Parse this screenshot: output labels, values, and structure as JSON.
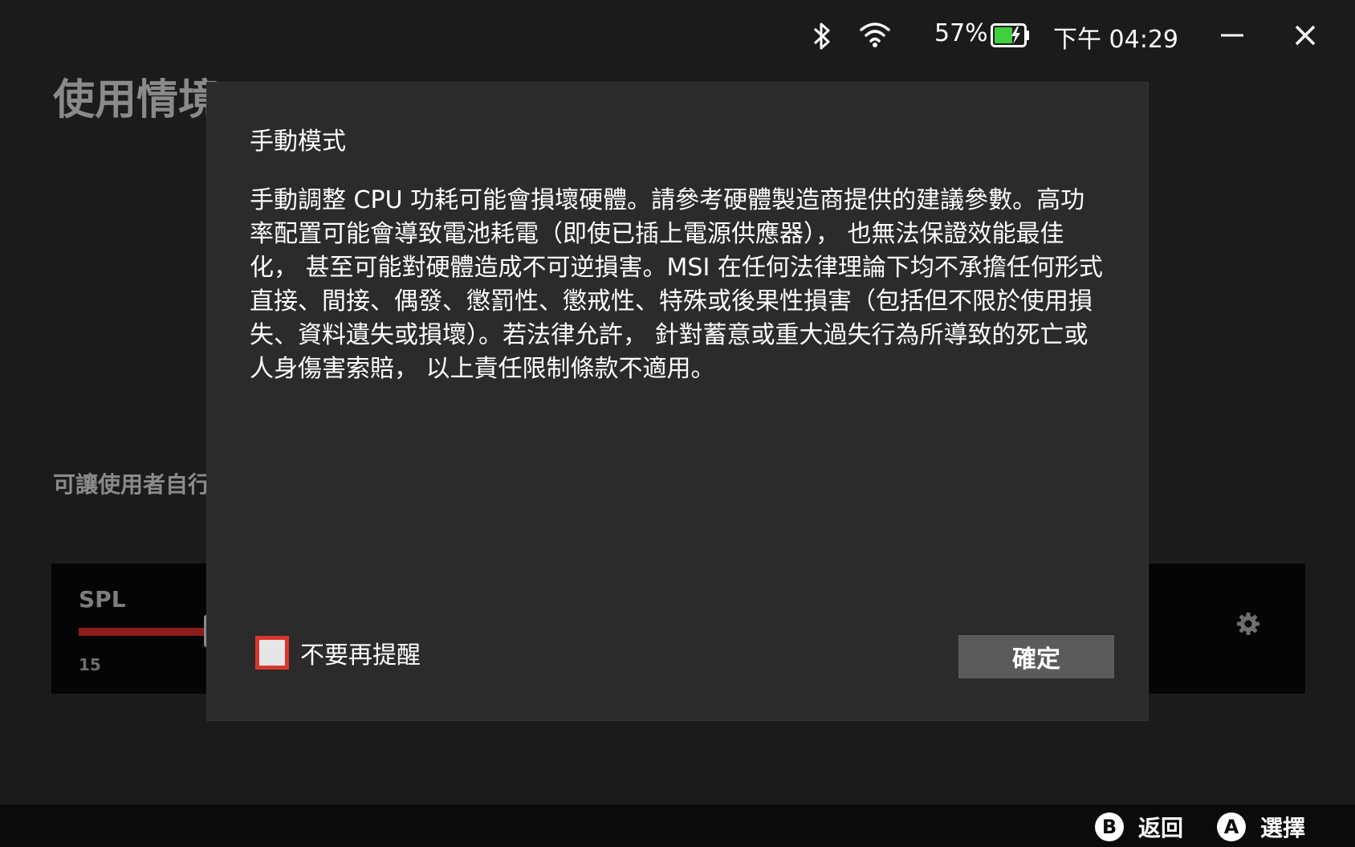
{
  "status_bar": {
    "battery_percent": "57%",
    "battery_level": 0.57,
    "battery_charging": true,
    "time": "下午 04:29",
    "icons": [
      "bluetooth-icon",
      "wifi-icon",
      "battery-icon",
      "minimize-icon",
      "close-icon"
    ]
  },
  "background": {
    "page_title": "使用情境",
    "section_subtitle": "可讓使用者自行",
    "spl": {
      "label": "SPL",
      "value": "15",
      "slider_color": "#8e1c1c"
    }
  },
  "dialog": {
    "title": "手動模式",
    "body": "手動調整 CPU 功耗可能會損壞硬體。請參考硬體製造商提供的建議參數。高功率配置可能會導致電池耗電（即使已插上電源供應器）， 也無法保證效能最佳化， 甚至可能對硬體造成不可逆損害。MSI 在任何法律理論下均不承擔任何形式直接、間接、偶發、懲罰性、懲戒性、特殊或後果性損害（包括但不限於使用損失、資料遺失或損壞）。若法律允許， 針對蓄意或重大過失行為所導致的死亡或人身傷害索賠， 以上責任限制條款不適用。",
    "dont_remind_label": "不要再提醒",
    "dont_remind_checked": false,
    "confirm_label": "確定",
    "accent_color": "#d9362b"
  },
  "bottom_bar": {
    "back": {
      "glyph": "B",
      "label": "返回"
    },
    "select": {
      "glyph": "A",
      "label": "選擇"
    }
  }
}
